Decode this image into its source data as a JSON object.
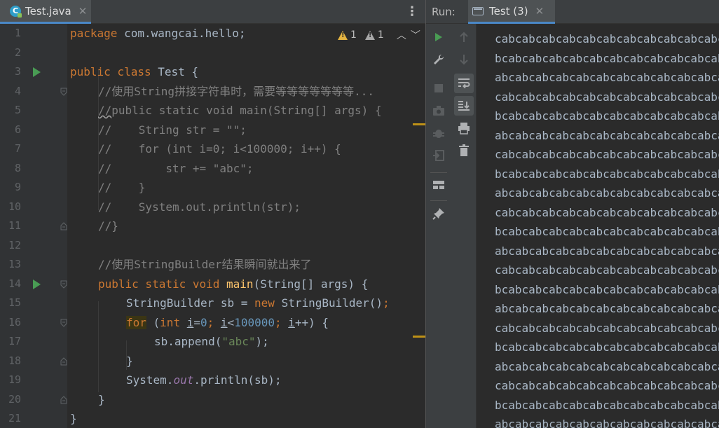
{
  "editor": {
    "tab": {
      "label": "Test.java",
      "icon": "java-class-icon"
    },
    "menu_icon": "more-vertical-icon",
    "inspection": {
      "warnings": "1",
      "weak_warnings": "1"
    },
    "line_numbers": [
      "1",
      "2",
      "3",
      "4",
      "5",
      "6",
      "7",
      "8",
      "9",
      "10",
      "11",
      "12",
      "13",
      "14",
      "15",
      "16",
      "17",
      "18",
      "19",
      "20",
      "21"
    ],
    "code": {
      "l1_kw": "package",
      "l1_pkg": " com.wangcai.hello;",
      "l3_kw": "public class",
      "l3_name": " Test {",
      "l4": "//使用String拼接字符串时，需要等等等等等等等...",
      "l5_slashes": "//",
      "l5_rest": "public static void main(String[] args) {",
      "l6": "//    String str = \"\";",
      "l7": "//    for (int i=0; i<100000; i++) {",
      "l8": "//        str += \"abc\";",
      "l9": "//    }",
      "l10": "//    System.out.println(str);",
      "l11": "//}",
      "l13": "//使用StringBuilder结果瞬间就出来了",
      "l14_kw": "public static void",
      "l14_fn": "main",
      "l14_rest": "(String[] args) {",
      "l15_a": "StringBuilder sb = ",
      "l15_kw": "new",
      "l15_b": " StringBuilder()",
      "l15_semi": ";",
      "l16_for": "for",
      "l16_a": " (",
      "l16_int": "int",
      "l16_sp": " ",
      "l16_i1": "i",
      "l16_eq": "=",
      "l16_zero": "0",
      "l16_semi1": "; ",
      "l16_i2": "i",
      "l16_lt": "<",
      "l16_num": "100000",
      "l16_semi2": "; ",
      "l16_i3": "i",
      "l16_inc": "++) {",
      "l17_a": "sb.append(",
      "l17_str": "\"abc\"",
      "l17_b": ");",
      "l18": "}",
      "l19_a": "System.",
      "l19_out": "out",
      "l19_b": ".println(sb);",
      "l20": "}",
      "l21": "}"
    }
  },
  "run": {
    "label": "Run:",
    "tab": {
      "label": "Test (3)",
      "icon": "console-icon"
    },
    "toolbar1_icons": [
      "rerun-icon",
      "wrench-icon",
      "stop-icon",
      "camera-icon",
      "debug-bug-icon",
      "exit-icon",
      "layout-icon",
      "pin-icon"
    ],
    "toolbar2_icons": [
      "up-arrow-icon",
      "down-arrow-icon",
      "soft-wrap-icon",
      "scroll-to-end-icon",
      "print-icon",
      "trash-icon"
    ],
    "output_lines": [
      "cabcabcabcabcabcabcabcabcabcabcabca",
      "bcabcabcabcabcabcabcabcabcabcabcabc",
      "abcabcabcabcabcabcabcabcabcabcabcab",
      "cabcabcabcabcabcabcabcabcabcabcabca",
      "bcabcabcabcabcabcabcabcabcabcabcabc",
      "abcabcabcabcabcabcabcabcabcabcabcab",
      "cabcabcabcabcabcabcabcabcabcabcabca",
      "bcabcabcabcabcabcabcabcabcabcabcabc",
      "abcabcabcabcabcabcabcabcabcabcabcab",
      "cabcabcabcabcabcabcabcabcabcabcabca",
      "bcabcabcabcabcabcabcabcabcabcabcabc",
      "abcabcabcabcabcabcabcabcabcabcabcab",
      "cabcabcabcabcabcabcabcabcabcabcabca",
      "bcabcabcabcabcabcabcabcabcabcabcabc",
      "abcabcabcabcabcabcabcabcabcabcabcab",
      "cabcabcabcabcabcabcabcabcabcabcabca",
      "bcabcabcabcabcabcabcabcabcabcabcabc",
      "abcabcabcabcabcabcabcabcabcabcabcab",
      "cabcabcabcabcabcabcabcabcabcabcabca",
      "bcabcabcabcabcabcabcabcabcabcabcabc",
      "abcabcabcabcabcabcabcabcabcabcabcab"
    ]
  },
  "colors": {
    "background": "#2b2b2b",
    "keyword": "#cc7832",
    "comment": "#808080",
    "string": "#6a8759",
    "number": "#6897bb",
    "function": "#ffc66d",
    "field": "#9876aa",
    "accent": "#4a88c7",
    "run_green": "#499c54"
  }
}
